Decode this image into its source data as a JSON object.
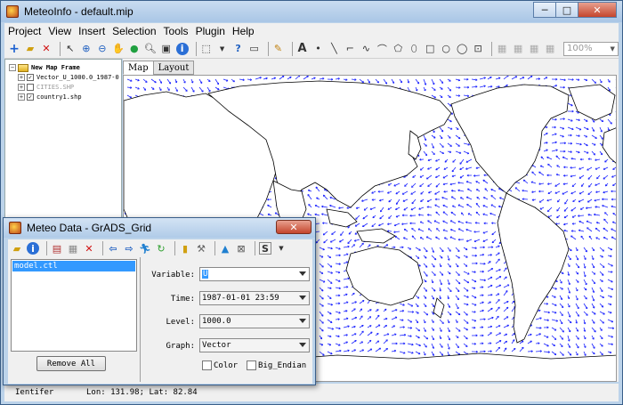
{
  "window": {
    "title": "MeteoInfo - default.mip",
    "minimize": "─",
    "maximize": "□",
    "close": "✕"
  },
  "menu": [
    "Project",
    "View",
    "Insert",
    "Selection",
    "Tools",
    "Plugin",
    "Help"
  ],
  "toolbar": {
    "zoom_value": "100%"
  },
  "layers": {
    "frame": "New Map Frame",
    "items": [
      {
        "label": "Vector_U_1000.0_1987-0",
        "checked": true,
        "faded": false
      },
      {
        "label": "CITIES.SHP",
        "checked": false,
        "faded": true
      },
      {
        "label": "country1.shp",
        "checked": true,
        "faded": false
      }
    ]
  },
  "tabs": [
    "Map",
    "Layout"
  ],
  "status": {
    "tool": "Ientifer",
    "coords": "Lon: 131.98; Lat: 82.84"
  },
  "dialog": {
    "title": "Meteo Data - GrADS_Grid",
    "close": "✕",
    "files": [
      "model.ctl"
    ],
    "remove_all": "Remove All",
    "fields": {
      "variable_label": "Variable:",
      "variable_value": "U",
      "time_label": "Time:",
      "time_value": "1987-01-01 23:59",
      "level_label": "Level:",
      "level_value": "1000.0",
      "graph_label": "Graph:",
      "graph_value": "Vector"
    },
    "options": {
      "color_label": "Color",
      "big_endian_label": "Big_Endian"
    }
  },
  "colors": {
    "vector": "#1a22ff",
    "selection": "#3399ff"
  }
}
